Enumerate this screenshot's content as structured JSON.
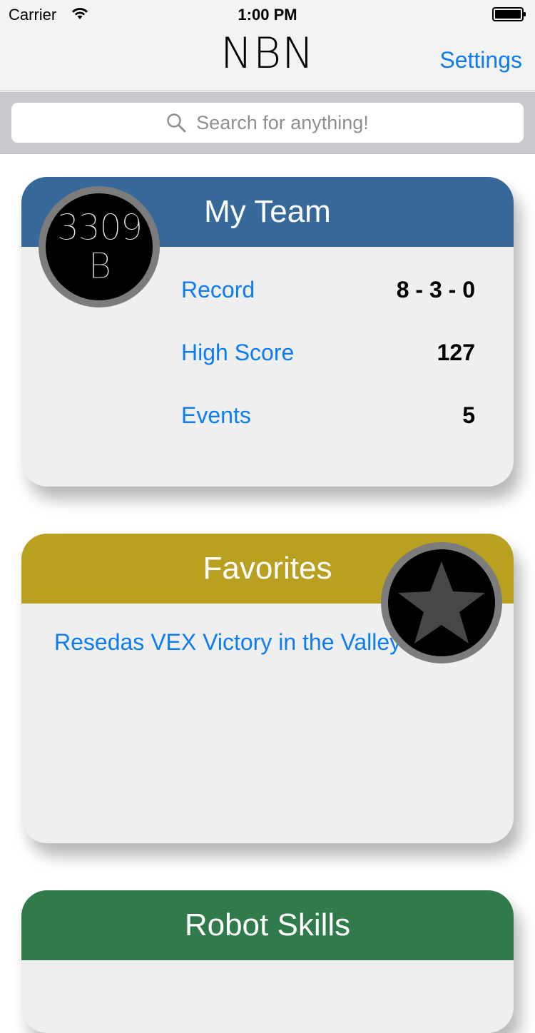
{
  "status_bar": {
    "carrier": "Carrier",
    "time": "1:00 PM"
  },
  "nav": {
    "title": "NBN",
    "settings_label": "Settings"
  },
  "search": {
    "placeholder": "Search for anything!"
  },
  "my_team": {
    "title": "My Team",
    "team_number": "3309",
    "team_letter": "B",
    "header_color": "#36699a",
    "stats": [
      {
        "label": "Record",
        "value": "8 - 3 - 0"
      },
      {
        "label": "High Score",
        "value": "127"
      },
      {
        "label": "Events",
        "value": "5"
      }
    ]
  },
  "favorites": {
    "title": "Favorites",
    "header_color": "#b9a020",
    "badge_icon": "star-icon",
    "items": [
      {
        "label": "Resedas VEX Victory in the Valley"
      }
    ]
  },
  "robot_skills": {
    "title": "Robot Skills",
    "header_color": "#317a4b"
  },
  "colors": {
    "accent": "#0d7cf2"
  }
}
